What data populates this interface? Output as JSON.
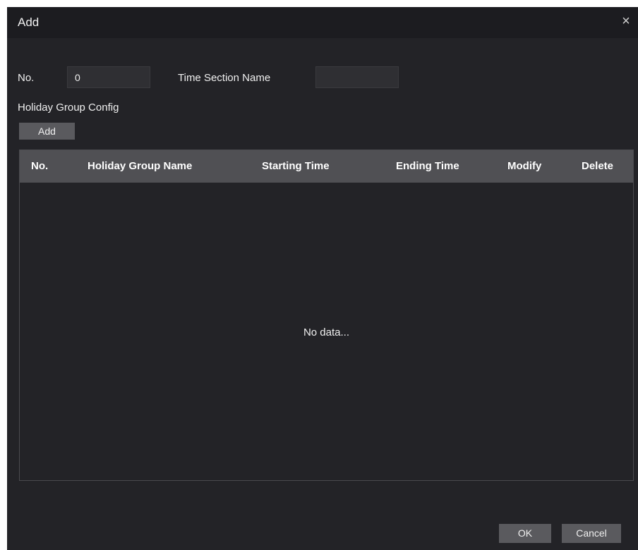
{
  "dialog": {
    "title": "Add",
    "close_glyph": "×"
  },
  "form": {
    "no_label": "No.",
    "no_value": "0",
    "time_section_label": "Time Section Name",
    "time_section_value": "",
    "holiday_group_label": "Holiday Group Config",
    "add_label": "Add"
  },
  "table": {
    "columns": [
      "No.",
      "Holiday Group Name",
      "Starting Time",
      "Ending Time",
      "Modify",
      "Delete"
    ],
    "empty_text": "No data..."
  },
  "footer": {
    "ok_label": "OK",
    "cancel_label": "Cancel"
  },
  "colors": {
    "background": "#232327",
    "header": "#505054",
    "button": "#5a5a5e"
  },
  "icons": {
    "close": "close-icon"
  }
}
